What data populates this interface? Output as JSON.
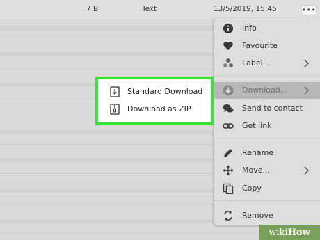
{
  "file_row": {
    "size": "7 B",
    "type": "Text",
    "modified": "13/5/2019, 15:45",
    "more_glyph": "•••"
  },
  "context_menu": {
    "items": [
      {
        "label": "Info",
        "icon": "info-icon"
      },
      {
        "label": "Favourite",
        "icon": "heart-icon"
      },
      {
        "label": "Label...",
        "icon": "label-dots-icon",
        "has_submenu": true
      },
      {
        "label": "Download...",
        "icon": "download-icon",
        "has_submenu": true,
        "active": true
      },
      {
        "label": "Send to contact",
        "icon": "chat-icon"
      },
      {
        "label": "Get link",
        "icon": "link-icon"
      },
      {
        "label": "Rename",
        "icon": "pencil-icon"
      },
      {
        "label": "Move...",
        "icon": "move-arrows-icon",
        "has_submenu": true
      },
      {
        "label": "Copy",
        "icon": "copy-icon"
      },
      {
        "label": "Remove",
        "icon": "remove-icon"
      }
    ]
  },
  "download_submenu": {
    "items": [
      {
        "label": "Standard Download",
        "icon": "download-file-icon"
      },
      {
        "label": "Download as ZIP",
        "icon": "zip-file-icon"
      }
    ],
    "highlight_color": "#3ae03a"
  },
  "watermark": {
    "part1": "wiki",
    "part2": "How"
  },
  "colors": {
    "menu_bg": "#dedede",
    "active_bg": "#b8b8b8",
    "page_bg": "#dadada"
  }
}
